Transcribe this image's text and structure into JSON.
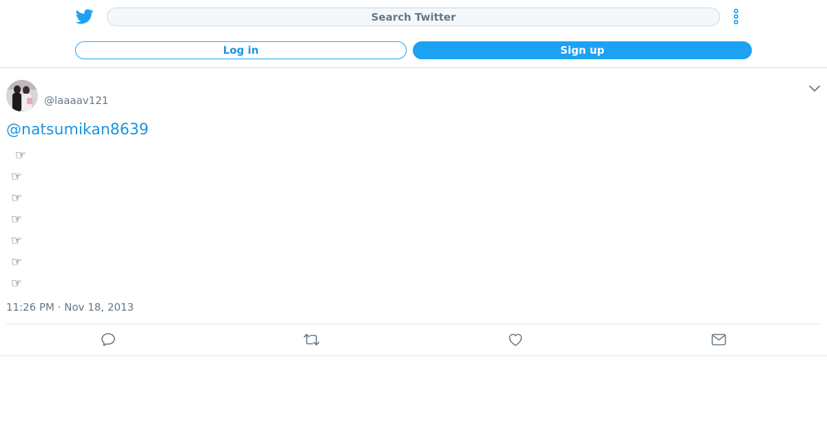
{
  "header": {
    "search_placeholder": "Search Twitter",
    "login_label": "Log in",
    "signup_label": "Sign up",
    "logo_icon": "twitter-bird-icon",
    "more_icon": "vertical-ellipsis-icon"
  },
  "tweet": {
    "handle": "@laaaav121",
    "mention": "@natsumikan8639",
    "lines": [
      "☞",
      "☞",
      "☞",
      "☞",
      "☞",
      "☞",
      "☞"
    ],
    "timestamp": "11:26 PM · Nov 18, 2013"
  },
  "actions": [
    {
      "icon": "reply-icon"
    },
    {
      "icon": "retweet-icon"
    },
    {
      "icon": "like-icon"
    },
    {
      "icon": "direct-message-icon"
    }
  ],
  "colors": {
    "accent": "#1da1f2",
    "link": "#1b95e0",
    "muted": "#657786"
  }
}
